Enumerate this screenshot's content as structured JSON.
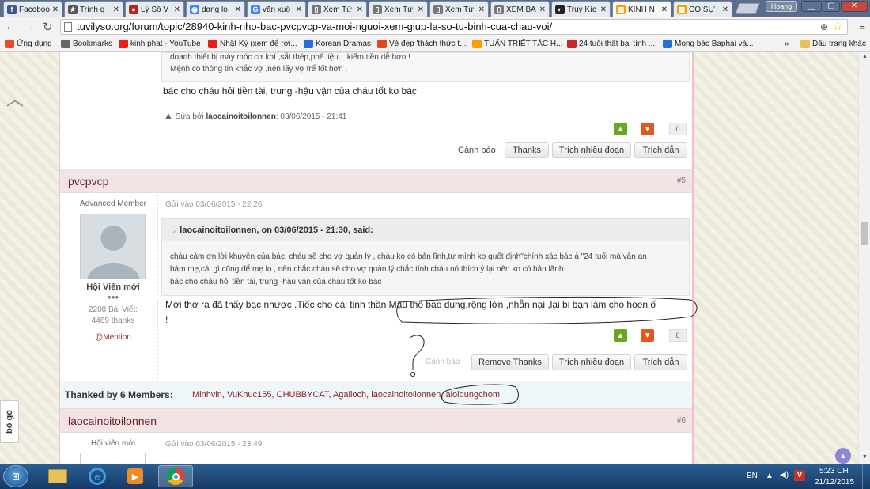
{
  "browser": {
    "tabs": [
      {
        "title": "Faceboo",
        "icon": "facebook-icon",
        "color": "#3b5998",
        "glyph": "f"
      },
      {
        "title": "Trình q",
        "icon": "star-icon",
        "color": "#555555",
        "glyph": "★"
      },
      {
        "title": "Lý Số V",
        "icon": "site-icon",
        "color": "#b0281e",
        "glyph": "●"
      },
      {
        "title": "dang lo",
        "icon": "chrome-icon",
        "color": "#4285f4",
        "glyph": "◉"
      },
      {
        "title": "văn xuô",
        "icon": "google-icon",
        "color": "#4285f4",
        "glyph": "G"
      },
      {
        "title": "Xem Tứ",
        "icon": "page-icon",
        "color": "#777777",
        "glyph": "▯"
      },
      {
        "title": "Xem Tử",
        "icon": "page-icon",
        "color": "#777777",
        "glyph": "▯"
      },
      {
        "title": "Xem Tứ",
        "icon": "page-icon",
        "color": "#777777",
        "glyph": "▯"
      },
      {
        "title": "XEM BÁ",
        "icon": "page-icon",
        "color": "#777777",
        "glyph": "▯"
      },
      {
        "title": "Truy Kíc",
        "icon": "mask-icon",
        "color": "#222222",
        "glyph": "◐"
      },
      {
        "title": "KÍNH N",
        "icon": "forum-icon",
        "color": "#f4a000",
        "glyph": "▦"
      },
      {
        "title": "CÓ SỰ",
        "icon": "forum-icon",
        "color": "#f4a000",
        "glyph": "▦"
      }
    ],
    "user_name": "Hoang",
    "url": "tuvilyso.org/forum/topic/28940-kinh-nho-bac-pvcpvcp-va-moi-nguoi-xem-giup-la-so-tu-binh-cua-chau-voi/",
    "bookmarks": [
      {
        "label": "Ứng dụng",
        "icon": "apps-icon",
        "color": "#e44d26"
      },
      {
        "label": "Bookmarks",
        "icon": "star-icon",
        "color": "#666666"
      },
      {
        "label": "kinh phat - YouTube",
        "icon": "youtube-icon",
        "color": "#e62117"
      },
      {
        "label": "Nhật Ký (xem để rơi...",
        "icon": "youtube-icon",
        "color": "#e62117"
      },
      {
        "label": "Korean Dramas",
        "icon": "drama-icon",
        "color": "#2c6bd6"
      },
      {
        "label": "Vẻ đẹp 'thách thức t...",
        "icon": "site-icon",
        "color": "#d94b1a"
      },
      {
        "label": "TUẤN TRIẾT TÁC H...",
        "icon": "forum-icon",
        "color": "#f4a000"
      },
      {
        "label": "24 tuổi thất bại tình ...",
        "icon": "news-icon",
        "color": "#c62828"
      },
      {
        "label": "Mong bác Baphái và...",
        "icon": "site-icon",
        "color": "#2a6fd0"
      }
    ],
    "bookmarks_more": "»",
    "bookmarks_other": "Dấu trang khác"
  },
  "post_prev": {
    "quote_lines": [
      "doanh thiết bị máy móc cơ khí ,sắt thép,phế liệu ...kiếm tiền dễ hơn !",
      "Mệnh có thông tin khắc vợ ,nên lấy vợ trể tốt hơn ."
    ],
    "body": "bác cho cháu hỏi tiền tài, trung -hậu vận của cháu tốt ko bác",
    "edit_prefix": "Sửa bởi",
    "edit_user": "laocainoitoilonnen",
    "edit_time": ": 03/06/2015 - 21:41",
    "score": "0",
    "report": "Cảnh báo",
    "thanks_btn": "Thanks",
    "multiquote_btn": "Trích nhiều đoạn",
    "quote_btn": "Trích dẫn"
  },
  "post5": {
    "username": "pvcpvcp",
    "number": "#5",
    "role": "Advanced Member",
    "rank": "Hội Viên mới",
    "rank_pips": "●●●",
    "post_count": "2208 Bài Viết:",
    "thanks_count": "4469 thanks",
    "mention": "@Mention",
    "posted": "Gửi vào 03/06/2015 - 22:26",
    "quote_head": "laocainoitoilonnen, on 03/06/2015 - 21:30, said:",
    "quote_lines": [
      "cháu cám ơn lời khuyên của bác. cháu sẽ cho vợ quản lý , cháu ko có bản lĩnh,tự mình ko quết định\"chính xác bác à \"24 tuổi mà vẫn an",
      "bám mẹ,cái gì cũng để mẹ lo , nên chắc cháu sẽ cho vợ quản lý chắc tính cháu nó thích ý lại nên ko có bản lãnh.",
      "bác cho cháu hỏi tiền tài, trung -hậu vận của cháu tốt ko bác"
    ],
    "body_line1": "Mới thở ra đã thấy bạc nhược .Tiếc cho cái tinh thần Mậu thổ bao dung,rộng lớn ,nhẫn nại ,lại bị bạn làm cho hoen ố",
    "body_line2": "!",
    "score": "0",
    "report": "Cảnh báo",
    "remove_thanks_btn": "Remove Thanks",
    "multiquote_btn": "Trích nhiều đoạn",
    "quote_btn": "Trích dẫn",
    "thanked_label": "Thanked by 6 Members:",
    "thanked_members": [
      "Minhvin",
      "VuKhuc155",
      "CHUBBYCAT",
      "Agalloch",
      "laocainoitoilonnen",
      "aioidungchom"
    ]
  },
  "post6": {
    "username": "laocainoitoilonnen",
    "number": "#6",
    "rank": "Hội viên mới",
    "posted": "Gửi vào 03/06/2015 - 23:49"
  },
  "page": {
    "side_widget": "bộ gõ"
  },
  "taskbar": {
    "lang": "EN",
    "time": "5:23 CH",
    "date": "21/12/2015"
  }
}
